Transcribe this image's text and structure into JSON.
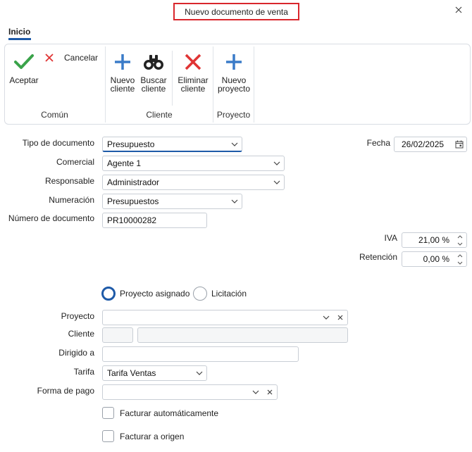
{
  "window": {
    "title": "Nuevo documento de venta",
    "close_icon": "close-icon"
  },
  "tabs": [
    {
      "label": "Inicio",
      "active": true
    }
  ],
  "ribbon": {
    "groups": [
      {
        "label": "Común",
        "buttons": [
          {
            "label": "Aceptar",
            "icon": "check-icon"
          },
          {
            "label": "Cancelar",
            "icon": "x-icon"
          }
        ]
      },
      {
        "label": "Cliente",
        "buttons": [
          {
            "label1": "Nuevo",
            "label2": "cliente",
            "icon": "plus-icon"
          },
          {
            "label1": "Buscar",
            "label2": "cliente",
            "icon": "binoculars-icon"
          },
          {
            "label1": "Eliminar",
            "label2": "cliente",
            "icon": "delete-x-icon"
          }
        ]
      },
      {
        "label": "Proyecto",
        "buttons": [
          {
            "label1": "Nuevo",
            "label2": "proyecto",
            "icon": "plus-icon"
          }
        ]
      }
    ]
  },
  "form": {
    "tipo_documento": {
      "label": "Tipo de documento",
      "value": "Presupuesto"
    },
    "comercial": {
      "label": "Comercial",
      "value": "Agente 1"
    },
    "responsable": {
      "label": "Responsable",
      "value": "Administrador"
    },
    "numeracion": {
      "label": "Numeración",
      "value": "Presupuestos"
    },
    "numero_documento": {
      "label": "Número de documento",
      "value": "PR10000282"
    },
    "fecha": {
      "label": "Fecha",
      "value": "26/02/2025"
    },
    "iva": {
      "label": "IVA",
      "value": "21,00 %"
    },
    "retencion": {
      "label": "Retención",
      "value": "0,00 %"
    },
    "radio_options": [
      {
        "label": "Proyecto asignado",
        "selected": true
      },
      {
        "label": "Licitación",
        "selected": false
      }
    ],
    "proyecto": {
      "label": "Proyecto",
      "value": ""
    },
    "cliente": {
      "label": "Cliente",
      "code": "",
      "name": ""
    },
    "dirigido_a": {
      "label": "Dirigido a",
      "value": ""
    },
    "tarifa": {
      "label": "Tarifa",
      "value": "Tarifa Ventas"
    },
    "forma_pago": {
      "label": "Forma de pago",
      "value": ""
    },
    "facturar_auto": {
      "label": "Facturar automáticamente",
      "checked": false
    },
    "facturar_origen": {
      "label": "Facturar a origen",
      "checked": false
    }
  },
  "colors": {
    "accent": "#1e5aa8",
    "title_border": "#d9262c",
    "accept_green": "#3aa34a",
    "delete_red": "#e03434",
    "plus_blue": "#3a7bc8"
  }
}
